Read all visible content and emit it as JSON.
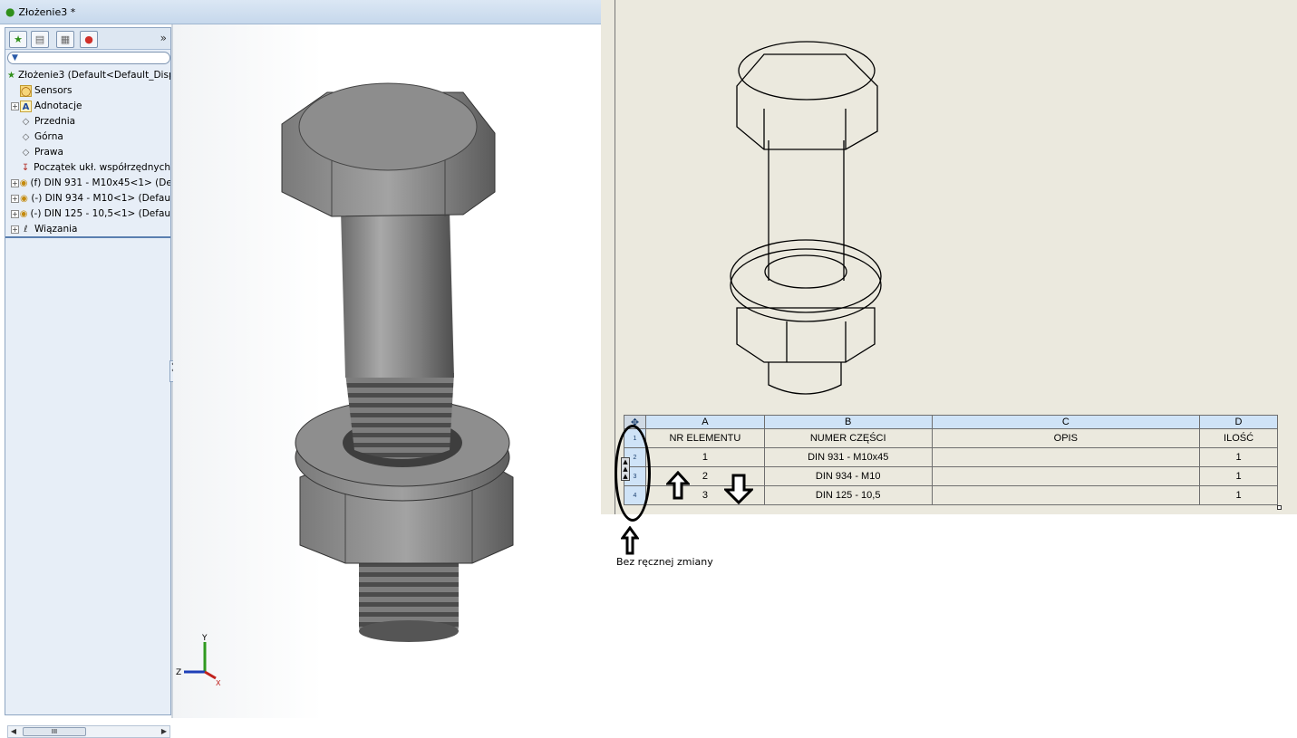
{
  "window": {
    "title": "Złożenie3 *"
  },
  "feature_manager": {
    "more_label": "»",
    "filter_label": "▾",
    "tree": [
      {
        "label": "Złożenie3  (Default<Default_Disp",
        "icon": "assembly-icon",
        "expandable": false
      },
      {
        "label": "Sensors",
        "icon": "sensors-folder-icon",
        "expandable": false
      },
      {
        "label": "Adnotacje",
        "icon": "annotations-icon",
        "expandable": true
      },
      {
        "label": "Przednia",
        "icon": "plane-icon",
        "expandable": false
      },
      {
        "label": "Górna",
        "icon": "plane-icon",
        "expandable": false
      },
      {
        "label": "Prawa",
        "icon": "plane-icon",
        "expandable": false
      },
      {
        "label": "Początek ukł. współrzędnych",
        "icon": "origin-icon",
        "expandable": false
      },
      {
        "label": "(f) DIN 931 - M10x45<1> (De",
        "icon": "part-icon",
        "expandable": true
      },
      {
        "label": "(-) DIN 934 - M10<1> (Defau",
        "icon": "part-icon",
        "expandable": true
      },
      {
        "label": "(-) DIN 125 - 10,5<1> (Defaul",
        "icon": "part-icon",
        "expandable": true
      },
      {
        "label": "Wiązania",
        "icon": "mates-icon",
        "expandable": true
      }
    ],
    "scroll_thumb_label": "III"
  },
  "triad": {
    "y_label": "Y",
    "z_label": "Z",
    "x_label": "X"
  },
  "bom": {
    "column_letters": [
      "A",
      "B",
      "C",
      "D"
    ],
    "row_numbers": [
      "1",
      "2",
      "3",
      "4"
    ],
    "headers": [
      "NR ELEMENTU",
      "NUMER CZĘŚCI",
      "OPIS",
      "ILOŚĆ"
    ],
    "rows": [
      {
        "item": "1",
        "part": "DIN 931 - M10x45",
        "desc": "",
        "qty": "1"
      },
      {
        "item": "2",
        "part": "DIN 934 - M10",
        "desc": "",
        "qty": "1"
      },
      {
        "item": "3",
        "part": "DIN 125 - 10,5",
        "desc": "",
        "qty": "1"
      }
    ]
  },
  "annotation": {
    "caption": "Bez ręcznej zmiany"
  },
  "colors": {
    "sheet": "#ebe9de",
    "table_header": "#cfe3f7",
    "metal_dark": "#5d5d5d",
    "metal_light": "#9a9a9a"
  }
}
